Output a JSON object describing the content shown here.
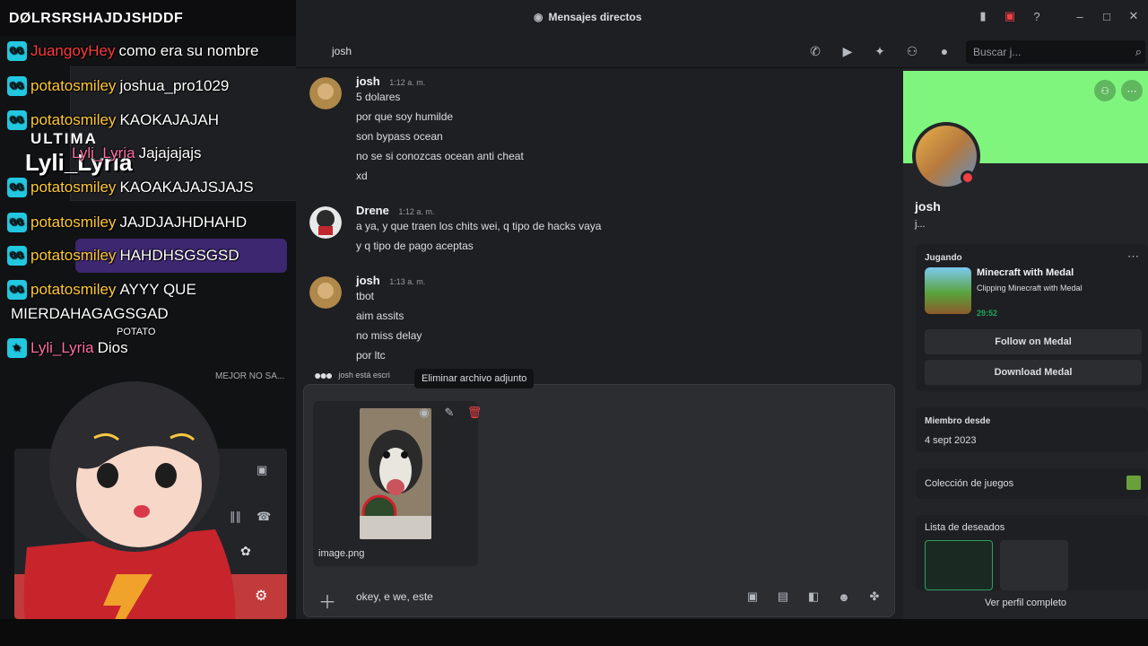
{
  "window": {
    "title": "Mensajes directos"
  },
  "overlay": {
    "top_text": "DØLRSRSHAJDJSHDDF",
    "ultima": "ULTIMA",
    "big_name": "Lyli_Lyria",
    "mejor": "MEJOR NO SA...",
    "chat": [
      {
        "user": "JuangoyHey",
        "msg": "como era su nombre",
        "color": "red"
      },
      {
        "user": "potatosmiley",
        "msg": "joshua_pro1029",
        "color": "yellow"
      },
      {
        "user": "potatosmiley",
        "msg": "KAOKAJAJAH",
        "color": "yellow"
      },
      {
        "user": "Lyli_Lyria",
        "msg": "Jajajajajs",
        "color": "pink"
      },
      {
        "user": "potatosmiley",
        "msg": "KAOAKAJAJSJAJS",
        "color": "yellow"
      },
      {
        "user": "potatosmiley",
        "msg": "JAJDJAJHDHAHD",
        "color": "yellow"
      },
      {
        "user": "potatosmiley",
        "msg": "HAHDHSGSGSD",
        "color": "yellow"
      },
      {
        "user": "potatosmiley",
        "msg": "AYYY QUE",
        "color": "yellow"
      },
      {
        "user": "",
        "msg": "MIERDAHAGAGSGAD",
        "color": "white"
      },
      {
        "user": "Lyli_Lyria",
        "msg": "Dios",
        "color": "pink"
      }
    ],
    "potato_tag": "POTATO"
  },
  "header": {
    "dm_name": "josh",
    "search_placeholder": "Buscar j..."
  },
  "messages": [
    {
      "author": "josh",
      "time": "1:12 a. m.",
      "lines": [
        "5 dolares",
        "por que soy humilde",
        "son bypass ocean",
        "no se si conozcas ocean anti cheat",
        "xd"
      ]
    },
    {
      "author": "Drene",
      "time": "1:12 a. m.",
      "lines": [
        "a ya, y que traen los chits wei, q tipo de hacks vaya",
        "y q tipo de pago aceptas"
      ]
    },
    {
      "author": "josh",
      "time": "1:13 a. m.",
      "lines": [
        "tbot",
        "aim assits",
        "no miss delay",
        "por ltc"
      ]
    }
  ],
  "typing": {
    "text": "josh está escri"
  },
  "tooltip": {
    "text": "Eliminar archivo adjunto"
  },
  "composer": {
    "filename": "image.png",
    "text": "okey, e we, este"
  },
  "profile": {
    "name": "josh",
    "status": "j...",
    "playing_label": "Jugando",
    "game_name": "Minecraft with Medal",
    "game_sub": "Clipping Minecraft with Medal",
    "game_time": "29:52",
    "follow_btn": "Follow on Medal",
    "download_btn": "Download Medal",
    "member_since_label": "Miembro desde",
    "member_since": "4 sept 2023",
    "games_label": "Colección de juegos",
    "wishlist_label": "Lista de deseados",
    "full_profile": "Ver perfil completo"
  },
  "colors": {
    "banner": "#7ff57e",
    "delete": "#f23f43",
    "online_time": "#23a55a"
  }
}
